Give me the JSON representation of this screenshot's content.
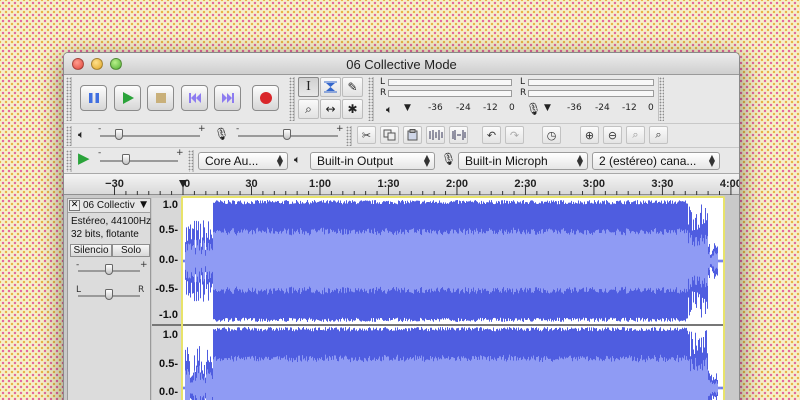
{
  "window": {
    "title": "06 Collective Mode"
  },
  "transport": {
    "buttons": [
      {
        "name": "pause-button",
        "icon": "pause-icon",
        "color": "#3f6ee0"
      },
      {
        "name": "play-button",
        "icon": "play-icon",
        "color": "#2aa33a"
      },
      {
        "name": "stop-button",
        "icon": "stop-icon",
        "color": "#c9b07a"
      },
      {
        "name": "skip-to-start-button",
        "icon": "skip-start-icon",
        "color": "#8d7cf0"
      },
      {
        "name": "skip-to-end-button",
        "icon": "skip-end-icon",
        "color": "#8d7cf0"
      },
      {
        "name": "record-button",
        "icon": "record-icon",
        "color": "#d9262a"
      }
    ]
  },
  "tools": {
    "selection": "I",
    "envelope": "envelope-icon",
    "draw": "✎",
    "zoom": "⌕",
    "timeshift": "↔",
    "multi": "✱"
  },
  "meters": {
    "playback": {
      "left": "L",
      "right": "R",
      "scale": [
        "-36",
        "-24",
        "-12",
        "0"
      ]
    },
    "record": {
      "left": "L",
      "right": "R",
      "scale": [
        "-36",
        "-24",
        "-12",
        "0"
      ]
    }
  },
  "mixer": {
    "vol_minus": "-",
    "vol_plus": "+",
    "rec_minus": "-",
    "rec_plus": "+"
  },
  "device": {
    "speed_minus": "-",
    "speed_plus": "+",
    "host": "Core Au...",
    "output": "Built-in Output",
    "input": "Built-in Microph",
    "channels": "2 (estéreo) cana..."
  },
  "ruler": {
    "labels": [
      "−30",
      "0",
      "30",
      "1:00",
      "1:30",
      "2:00",
      "2:30",
      "3:00",
      "3:30",
      "4:00"
    ]
  },
  "track": {
    "name": "06 Collectiv",
    "rate": "Estéreo, 44100Hz",
    "format": "32 bits, flotante",
    "mute": "Silencio",
    "solo": "Solo",
    "gain_minus": "-",
    "gain_plus": "+",
    "pan_left": "L",
    "pan_right": "R",
    "yaxis_top": [
      "1.0",
      "0.5-",
      "0.0-",
      "-0.5-",
      "-1.0"
    ],
    "yaxis_bottom": [
      "1.0",
      "0.5-",
      "0.0-"
    ],
    "wave_color": "#4f5de0",
    "wave_light": "#8f9bf4"
  }
}
